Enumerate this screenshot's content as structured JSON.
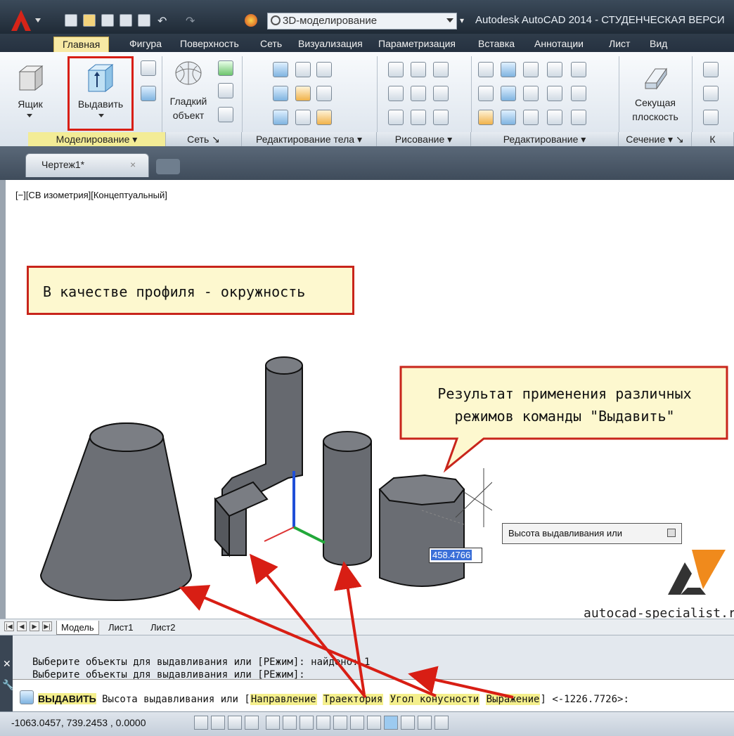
{
  "title_bar": {
    "app_title": "Autodesk AutoCAD 2014 - СТУДЕНЧЕСКАЯ ВЕРСИ",
    "workspace": "3D-моделирование"
  },
  "tabs": [
    {
      "label": "Главная",
      "active": true
    },
    {
      "label": "Фигура"
    },
    {
      "label": "Поверхность"
    },
    {
      "label": "Сеть"
    },
    {
      "label": "Визуализация"
    },
    {
      "label": "Параметризация"
    },
    {
      "label": "Вставка"
    },
    {
      "label": "Аннотации"
    },
    {
      "label": "Лист"
    },
    {
      "label": "Вид"
    }
  ],
  "ribbon": {
    "box_label": "Ящик",
    "extrude_label": "Выдавить",
    "smooth_label_1": "Гладкий",
    "smooth_label_2": "объект",
    "section_label_1": "Секущая",
    "section_label_2": "плоскость",
    "panels": [
      {
        "label": "Моделирование ▾"
      },
      {
        "label": "Сеть ↘"
      },
      {
        "label": "Редактирование тела ▾"
      },
      {
        "label": "Рисование ▾"
      },
      {
        "label": "Редактирование ▾"
      },
      {
        "label": "Сечение ▾ ↘"
      },
      {
        "label": "К"
      }
    ]
  },
  "file_tab": {
    "label": "Чертеж1*",
    "close": "×"
  },
  "viewport": {
    "label": "[−][СВ изометрия][Концептуальный]",
    "callout1": "В качестве профиля - окружность",
    "callout2_line1": "Результат применения различных",
    "callout2_line2": "режимов команды \"Выдавить\"",
    "tooltip": "Высота выдавливания или",
    "input_value": "458.4766",
    "watermark": "autocad-specialist.ru"
  },
  "layout_tabs": [
    "Модель",
    "Лист1",
    "Лист2"
  ],
  "command": {
    "history": [
      "Выберите объекты для выдавливания или [РЕжим]: найдено: 1",
      "Выберите объекты для выдавливания или [РЕжим]:"
    ],
    "cmd_name": "ВЫДАВИТЬ",
    "prompt": "Высота выдавливания или [",
    "options": [
      "Направление",
      "Траектория",
      "Угол конусности",
      "Выражение"
    ],
    "suffix": "] <-1226.7726>:"
  },
  "status": {
    "coords": "-1063.0457, 739.2453 , 0.0000"
  },
  "colors": {
    "highlight_red": "#d81e14",
    "yellow": "#f7e9a4",
    "solid_gray": "#6a6d72"
  }
}
